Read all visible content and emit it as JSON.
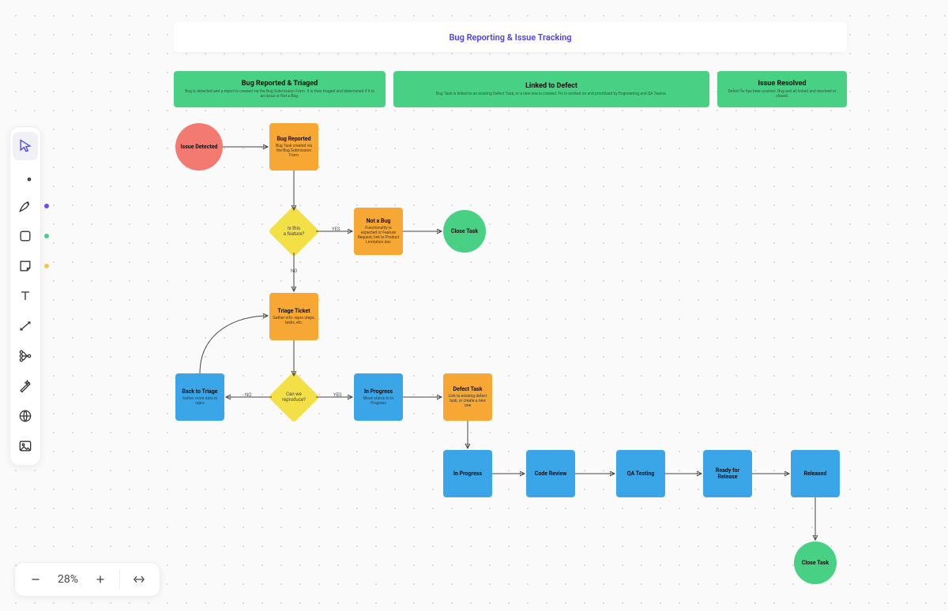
{
  "title": "Bug Reporting & Issue Tracking",
  "zoom_label": "28%",
  "tool_dots": {
    "pen": "#6b4bff",
    "shape": "#48d184",
    "sticky": "#f6c54a"
  },
  "lanes": [
    {
      "title": "Bug Reported & Triaged",
      "sub": "Bug is detected and a report is created via the Bug Submission Form. It is then triaged and determined if it is an issue or Not a Bug."
    },
    {
      "title": "Linked to Defect",
      "sub": "Bug Task is linked to an existing Defect Task, or a new one is created. Fix is worked on and prioritized by Engineering and QA Teams."
    },
    {
      "title": "Issue Resolved",
      "sub": "Defect fix has been pushed. Bug and all linked and resolved or closed."
    }
  ],
  "nodes": {
    "issue_detected": {
      "title": "Issue Detected"
    },
    "bug_reported": {
      "title": "Bug Reported",
      "sub": "Bug Task created via the Bug Submission Form"
    },
    "d_is_bug": {
      "line1": "Is this",
      "line2": "a feature?"
    },
    "not_a_bug": {
      "title": "Not a Bug",
      "sub": "Functionality is expected or Feature Request, link to Product Limitation doc"
    },
    "close_task_1": {
      "title": "Close Task"
    },
    "triage": {
      "title": "Triage Ticket",
      "sub": "Gather info: repro steps, tasks, etc."
    },
    "d_reproduce": {
      "line1": "Can we",
      "line2": "reproduce?"
    },
    "back_triage": {
      "title": "Back to Triage",
      "sub": "Gather more data to repro"
    },
    "in_progress_1": {
      "title": "In Progress",
      "sub": "Move status to In Progress"
    },
    "defect_task": {
      "title": "Defect Task",
      "sub": "Link to existing defect task, or create a new one"
    },
    "in_progress_2": {
      "title": "In Progress"
    },
    "code_review": {
      "title": "Code Review"
    },
    "qa_testing": {
      "title": "QA Testing"
    },
    "ready_release": {
      "title": "Ready for Release"
    },
    "released": {
      "title": "Released"
    },
    "close_task_2": {
      "title": "Close Task"
    }
  },
  "edge_labels": {
    "yes1": "YES",
    "no1": "NO",
    "yes2": "YES",
    "no2": "NO"
  }
}
